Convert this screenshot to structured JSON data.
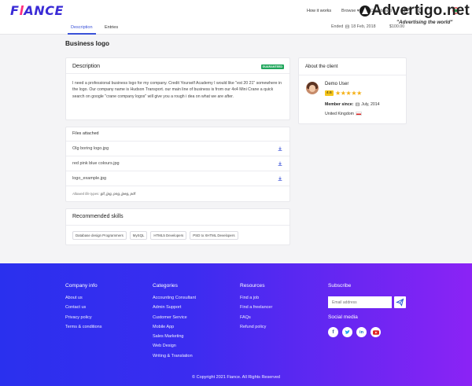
{
  "header": {
    "logo_main": "F",
    "logo_accent": "l",
    "logo_rest": "ANCE",
    "nav": {
      "how_it_works": "How it works",
      "browse": "Browse",
      "dashboard": "Dashboard"
    },
    "icons": [
      "mail-icon",
      "bell-icon",
      "avatar-icon"
    ]
  },
  "watermark": {
    "title": "Advertigo.net",
    "tagline": "\"Advertising the world\""
  },
  "tabs": {
    "description": "Description",
    "entries": "Entries"
  },
  "project_meta": {
    "ended": "Ended",
    "ended_date": "18 Feb, 2018",
    "budget": "$100.00"
  },
  "page": {
    "title": "Business logo"
  },
  "description": {
    "title": "Description",
    "badge": "GUARANTEED",
    "text": "I need a professional business logo for my company. Credit Yourself Academy I would like \"est 20 21\" somewhere in the logo. Our company name is Hudson Transport. our main line of business is from our 4x4 Mini Crane a quick search on google \"crane company logos\" will give you a rough i dea on what we are after."
  },
  "files": {
    "title": "Files attached",
    "items": [
      {
        "name": "Olg boring logo.jpg"
      },
      {
        "name": "red pink blue colours.jpg"
      },
      {
        "name": "logo_example.jpg"
      }
    ],
    "allowed_label": "Allowed file types:",
    "allowed_types": "gif, jpg, png, jpeg, pdf"
  },
  "skills": {
    "title": "Recommended skills",
    "items": [
      "Database design Programmers",
      "MySQL",
      "HTML5 Developers",
      "PSD to XHTML Developers"
    ]
  },
  "client": {
    "title": "About the client",
    "name": "Demo User",
    "rating": "4.6",
    "stars": "★★★★★",
    "member_label": "Member since:",
    "member_date": "July, 2014",
    "country": "United Kingdom"
  },
  "footer": {
    "company_info": {
      "title": "Company info",
      "links": [
        "About us",
        "Contact us",
        "Privacy policy",
        "Terms & conditions"
      ]
    },
    "categories": {
      "title": "Categories",
      "links": [
        "Accounting Consultant",
        "Admin Support",
        "Customer Service",
        "Mobile App",
        "Sales Marketing",
        "Web Design",
        "Writing & Translation"
      ]
    },
    "resources": {
      "title": "Resources",
      "links": [
        "Find a job",
        "Find a freelancer",
        "FAQs",
        "Refund policy"
      ]
    },
    "subscribe": {
      "title": "Subscribe",
      "placeholder": "Email address",
      "social_title": "Social media",
      "social": [
        "facebook-icon",
        "twitter-icon",
        "linkedin-icon",
        "youtube-icon"
      ]
    },
    "copyright": "© Copyright 2021 Fiance. All Rights Reserved"
  },
  "colors": {
    "brand": "#3a2bd6",
    "accent": "#ff2e7e",
    "link": "#3a52d8",
    "badge": "#1fa65b",
    "footer_start": "#2a30ee",
    "footer_end": "#8b23f5"
  }
}
